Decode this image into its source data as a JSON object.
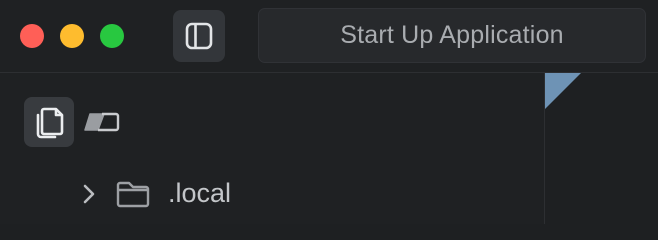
{
  "window": {
    "controls": [
      "close",
      "minimize",
      "maximize"
    ]
  },
  "toolbar": {
    "sidebar_toggle_icon": "sidebar-toggle-icon",
    "run_target_label": "Start Up Application"
  },
  "sidebar": {
    "nav": [
      {
        "name": "files",
        "icon": "files-icon",
        "active": true
      },
      {
        "name": "tags",
        "icon": "tags-icon",
        "active": false
      }
    ],
    "tree": [
      {
        "label": ".local",
        "type": "folder",
        "expanded": false
      }
    ]
  },
  "colors": {
    "close": "#ff5f57",
    "minimize": "#febc2e",
    "maximize": "#28c840",
    "background": "#1e2022",
    "accent": "#6e93b5"
  }
}
